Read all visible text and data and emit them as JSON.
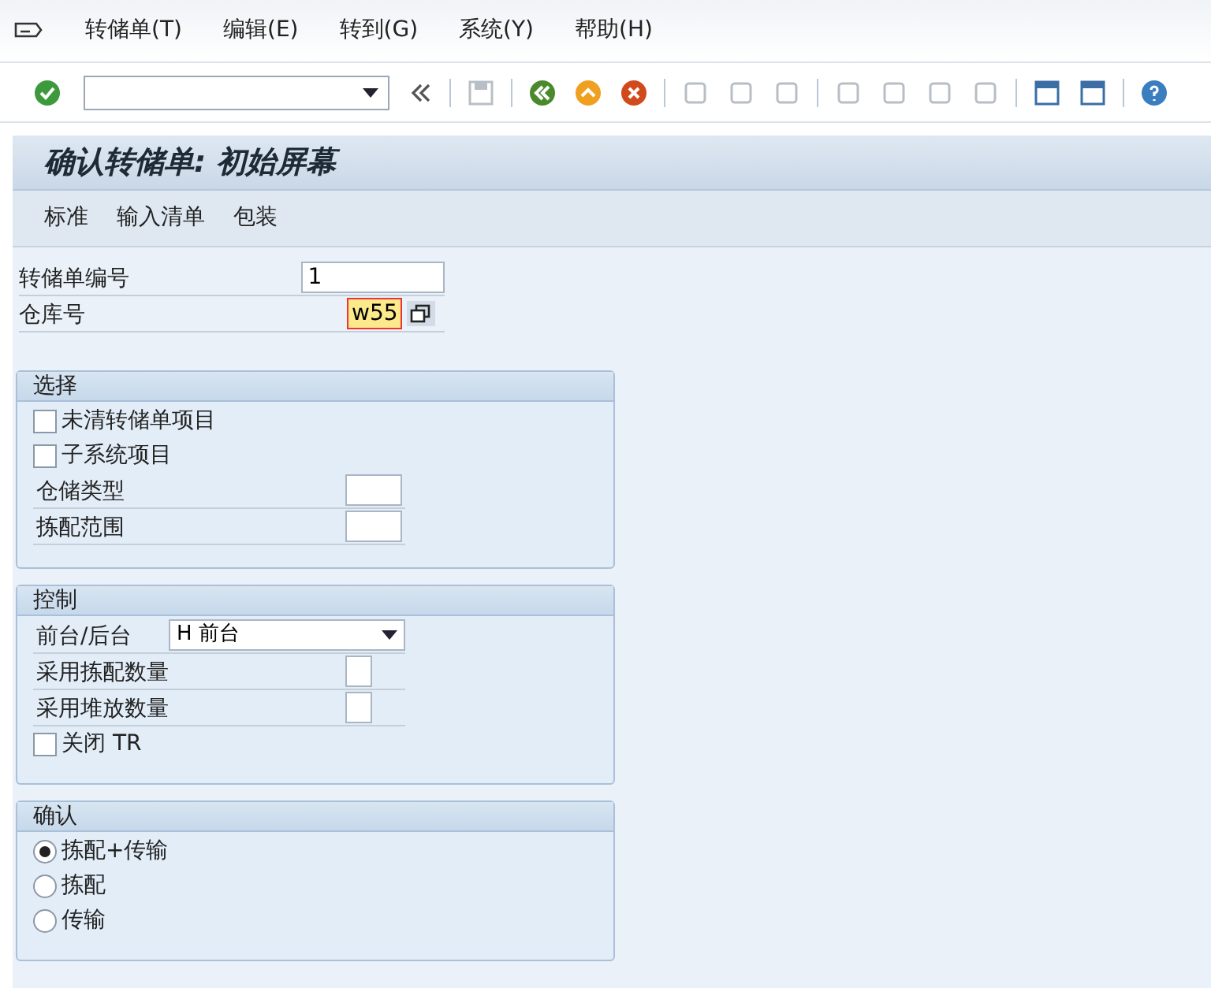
{
  "menu": [
    {
      "label": "转储单(T)"
    },
    {
      "label": "编辑(E)"
    },
    {
      "label": "转到(G)"
    },
    {
      "label": "系统(Y)"
    },
    {
      "label": "帮助(H)"
    }
  ],
  "toolbar": {
    "buttons": [
      {
        "disabled": false
      },
      {
        "disabled": false
      },
      {
        "disabled": true
      },
      {
        "disabled": false
      },
      {
        "disabled": false
      },
      {
        "disabled": false
      },
      {
        "disabled": true
      },
      {
        "disabled": true
      },
      {
        "disabled": true
      },
      {
        "disabled": true
      },
      {
        "disabled": true
      },
      {
        "disabled": true
      },
      {
        "disabled": true
      },
      {
        "disabled": false
      },
      {
        "disabled": false
      },
      {
        "disabled": false
      }
    ]
  },
  "title": "确认转储单: 初始屏幕",
  "app_toolbar": [
    {
      "label": "标准"
    },
    {
      "label": "输入清单"
    },
    {
      "label": "包装"
    }
  ],
  "header_fields": [
    {
      "label": "转储单编号",
      "value": "1",
      "focused": false
    },
    {
      "label": "仓库号",
      "value": "w55",
      "focused": true
    }
  ],
  "groups": [
    {
      "title": "选择",
      "items": [
        {
          "kind": "checkbox",
          "label": "未清转储单项目",
          "checked": false
        },
        {
          "kind": "checkbox",
          "label": "子系统项目",
          "checked": false
        },
        {
          "kind": "input",
          "label": "仓储类型"
        },
        {
          "kind": "input",
          "label": "拣配范围"
        }
      ]
    },
    {
      "title": "控制",
      "items": [
        {
          "kind": "dropdown",
          "label": "前台/后台",
          "value": "H 前台"
        },
        {
          "kind": "flag",
          "label": "采用拣配数量"
        },
        {
          "kind": "flag",
          "label": "采用堆放数量"
        },
        {
          "kind": "checkbox",
          "label": "关闭 TR",
          "checked": false
        }
      ]
    },
    {
      "title": "确认",
      "items": [
        {
          "kind": "radio",
          "label": "拣配+传输",
          "selected": true
        },
        {
          "kind": "radio",
          "label": "拣配",
          "selected": false
        },
        {
          "kind": "radio",
          "label": "传输",
          "selected": false
        }
      ]
    }
  ]
}
